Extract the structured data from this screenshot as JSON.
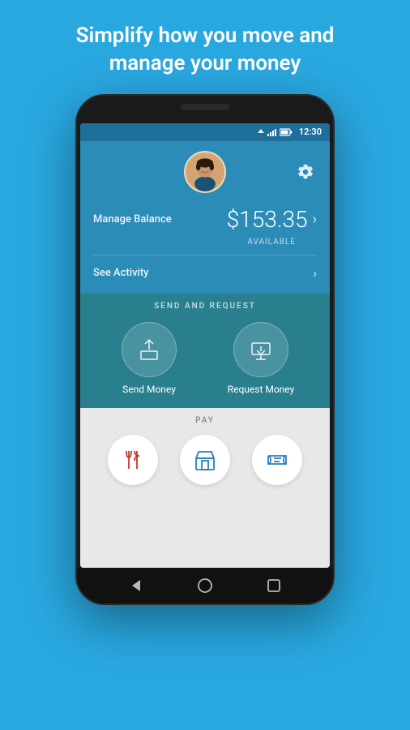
{
  "page": {
    "background_color": "#29a8e0",
    "title_line1": "Simplify how you move and",
    "title_line2": "manage your money"
  },
  "status_bar": {
    "time": "12:30"
  },
  "header": {
    "manage_balance_label": "Manage Balance",
    "balance": "$153.35",
    "available_label": "AVAILABLE",
    "see_activity_label": "See Activity",
    "gear_label": "Settings"
  },
  "send_request": {
    "section_label": "SEND AND REQUEST",
    "send_label": "Send Money",
    "request_label": "Request Money"
  },
  "pay": {
    "section_label": "PAY",
    "items": [
      {
        "name": "restaurants",
        "icon": "utensils"
      },
      {
        "name": "store",
        "icon": "store"
      },
      {
        "name": "ticket",
        "icon": "ticket"
      }
    ]
  },
  "nav": {
    "back_label": "Back",
    "home_label": "Home",
    "recent_label": "Recent Apps"
  }
}
